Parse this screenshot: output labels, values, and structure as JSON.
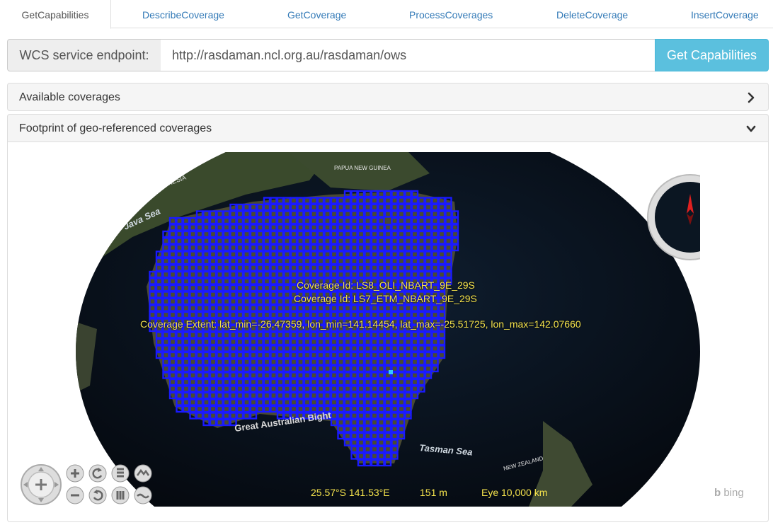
{
  "tabs": [
    "GetCapabilities",
    "DescribeCoverage",
    "GetCoverage",
    "ProcessCoverages",
    "DeleteCoverage",
    "InsertCoverage"
  ],
  "endpoint": {
    "label": "WCS service endpoint:",
    "value": "http://rasdaman.ncl.org.au/rasdaman/ows",
    "button": "Get Capabilities"
  },
  "panels": {
    "available": "Available coverages",
    "footprint": "Footprint of geo-referenced coverages"
  },
  "map": {
    "place_labels": [
      "Java Sea",
      "INDONESIA",
      "PAPUA NEW GUINEA",
      "Great Australian Bight",
      "Tasman Sea",
      "NEW ZEALAND"
    ],
    "coverage_ids": [
      "Coverage Id: LS8_OLI_NBART_9E_29S",
      "Coverage Id: LS7_ETM_NBART_9E_29S"
    ],
    "coverage_extent": "Coverage Extent: lat_min=-26.47359, lon_min=141.14454, lat_max=-25.51725, lon_max=142.07660",
    "status": {
      "position": "25.57°S 141.53°E",
      "altitude": "151 m",
      "eye": "Eye  10,000 km"
    },
    "attribution": "bing",
    "footprint_color": "#1a1aff",
    "highlight_color": "#33ccff"
  }
}
